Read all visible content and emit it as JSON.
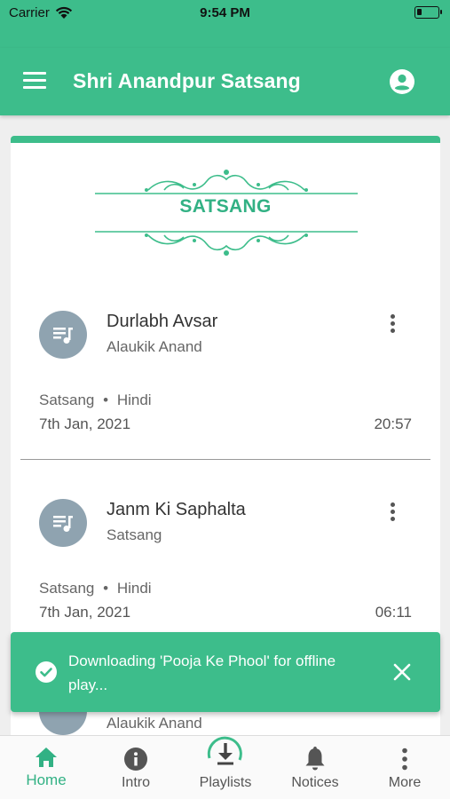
{
  "status_bar": {
    "carrier": "Carrier",
    "time": "9:54 PM"
  },
  "app_bar": {
    "title": "Shri Anandpur Satsang"
  },
  "section": {
    "heading": "SATSANG"
  },
  "tracks": [
    {
      "title": "Durlabh Avsar",
      "artist": "Alaukik Anand",
      "category": "Satsang",
      "language": "Hindi",
      "separator": "•",
      "date": "7th Jan, 2021",
      "duration": "20:57"
    },
    {
      "title": "Janm Ki Saphalta",
      "artist": "Satsang",
      "category": "Satsang",
      "language": "Hindi",
      "separator": "•",
      "date": "7th Jan, 2021",
      "duration": "06:11"
    },
    {
      "artist": "Alaukik Anand"
    }
  ],
  "toast": {
    "message": "Downloading 'Pooja Ke Phool' for offline play..."
  },
  "bottom_nav": {
    "items": [
      {
        "label": "Home",
        "icon": "home-icon",
        "active": true
      },
      {
        "label": "Intro",
        "icon": "info-icon"
      },
      {
        "label": "Playlists",
        "icon": "download-progress-icon"
      },
      {
        "label": "Notices",
        "icon": "bell-icon"
      },
      {
        "label": "More",
        "icon": "more-vertical-icon"
      }
    ]
  },
  "colors": {
    "accent": "#3dbd8b",
    "accent_dark": "#32b184",
    "artwork_bg": "#8fa3b0"
  }
}
